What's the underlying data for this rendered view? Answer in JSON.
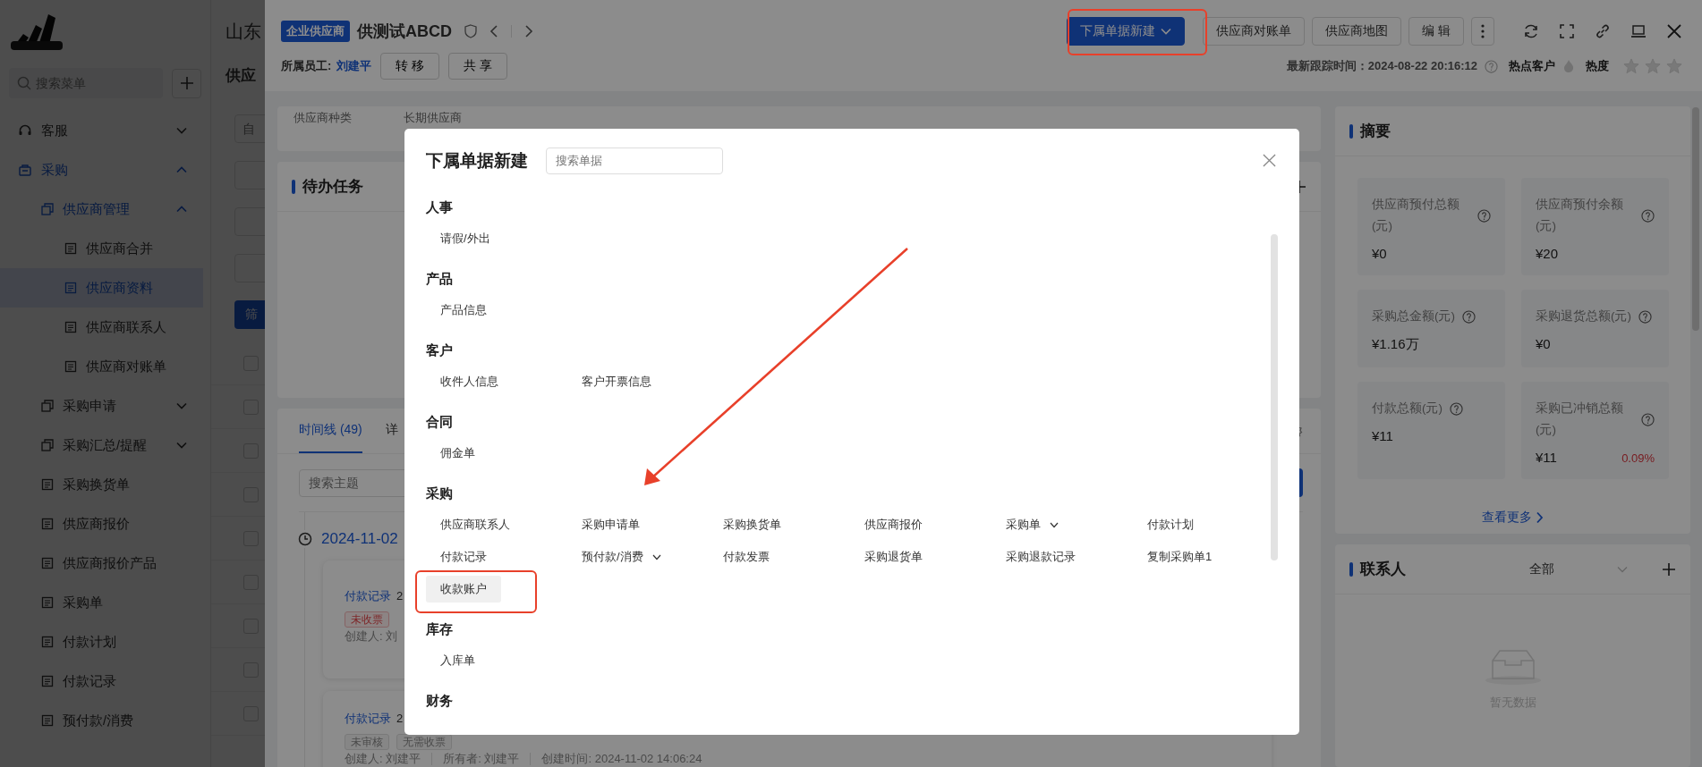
{
  "sidebar": {
    "search": {
      "placeholder": "搜索菜单"
    },
    "items": [
      {
        "label": "客服",
        "expanded": false
      },
      {
        "label": "采购",
        "expanded": true,
        "children": [
          {
            "label": "供应商管理",
            "expanded": true,
            "children": [
              {
                "label": "供应商合并",
                "selected": false
              },
              {
                "label": "供应商资料",
                "selected": true
              },
              {
                "label": "供应商联系人",
                "selected": false
              },
              {
                "label": "供应商对账单",
                "selected": false
              }
            ]
          },
          {
            "label": "采购申请",
            "expanded": false
          },
          {
            "label": "采购汇总/提醒",
            "expanded": false
          },
          {
            "label": "采购换货单",
            "selected": false
          },
          {
            "label": "供应商报价",
            "selected": false
          },
          {
            "label": "供应商报价产品",
            "selected": false
          },
          {
            "label": "采购单",
            "selected": false
          },
          {
            "label": "付款计划",
            "selected": false
          },
          {
            "label": "付款记录",
            "selected": false
          },
          {
            "label": "预付款/消费",
            "selected": false
          }
        ]
      }
    ]
  },
  "list_page": {
    "title": "山东",
    "subtitle": "供应",
    "filter_field": {
      "placeholder": "自"
    },
    "filter_button": "筛",
    "rows": [
      {
        "checked": false
      },
      {
        "checked": false
      },
      {
        "checked": false
      },
      {
        "checked": false
      },
      {
        "checked": false
      },
      {
        "checked": false
      },
      {
        "checked": false
      },
      {
        "checked": false
      },
      {
        "checked": false
      }
    ]
  },
  "drawer": {
    "tag": "企业供应商",
    "title": "供测试ABCD",
    "owner_label": "所属员工:",
    "owner": "刘建平",
    "buttons": [
      "转 移",
      "共 享"
    ],
    "actions": [
      {
        "label": "下属单据新建",
        "kind": "primary"
      },
      {
        "label": "供应商对账单",
        "kind": "default"
      },
      {
        "label": "供应商地图",
        "kind": "default"
      },
      {
        "label": "编 辑",
        "kind": "default"
      }
    ],
    "last_tracked": "最新跟踪时间：2024-08-22 20:16:12",
    "hot_label": "热点客户",
    "heat": {
      "label": "热度",
      "stars": 0
    },
    "info_labels": [
      "供应商种类",
      "长期供应商"
    ],
    "tasks": {
      "title": "待办任务"
    },
    "timeline": {
      "tabs": [
        {
          "label": "时间线 (49)",
          "selected": true
        },
        {
          "label": "详",
          "selected": false
        }
      ],
      "search": {
        "placeholder": "搜索主题"
      },
      "date": "2024-11-02",
      "entries": [
        {
          "type": "付款记录",
          "time": "2",
          "tags": [
            {
              "label": "未收票",
              "kind": "danger"
            }
          ],
          "meta": [
            "创建人: 刘"
          ]
        },
        {
          "type": "付款记录",
          "time": "2",
          "tags": [
            {
              "label": "未审核",
              "kind": "default"
            },
            {
              "label": "无需收票",
              "kind": "default"
            }
          ],
          "meta": [
            "创建人: 刘建平",
            "所有者: 刘建平",
            "创建时间: 2024-11-02 14:06:24"
          ]
        }
      ]
    },
    "summary": {
      "title": "摘要",
      "stats": [
        {
          "label": "供应商预付总额(元)",
          "value": "¥0"
        },
        {
          "label": "供应商预付余额(元)",
          "value": "¥20"
        },
        {
          "label": "采购总金额(元)",
          "value": "¥1.16万"
        },
        {
          "label": "采购退货总额(元)",
          "value": "¥0"
        },
        {
          "label": "付款总额(元)",
          "value": "¥11"
        },
        {
          "label": "采购已冲销总额(元)",
          "value": "¥11",
          "ratio": "0.09%"
        }
      ],
      "more_link": "查看更多"
    },
    "contacts": {
      "title": "联系人",
      "filter": "全部",
      "empty_text": "暂无数据"
    }
  },
  "modal": {
    "title": "下属单据新建",
    "search": {
      "placeholder": "搜索单据"
    },
    "sections": [
      {
        "title": "人事",
        "items": [
          {
            "label": "请假/外出",
            "kind": "link",
            "selected": false
          }
        ]
      },
      {
        "title": "产品",
        "items": [
          {
            "label": "产品信息",
            "kind": "link",
            "selected": false
          }
        ]
      },
      {
        "title": "客户",
        "items": [
          {
            "label": "收件人信息",
            "kind": "link",
            "selected": false
          },
          {
            "label": "客户开票信息",
            "kind": "link",
            "selected": false
          }
        ]
      },
      {
        "title": "合同",
        "items": [
          {
            "label": "佣金单",
            "kind": "link",
            "selected": false
          }
        ]
      },
      {
        "title": "采购",
        "items": [
          {
            "label": "供应商联系人",
            "kind": "link",
            "selected": false
          },
          {
            "label": "采购申请单",
            "kind": "link",
            "selected": false
          },
          {
            "label": "采购换货单",
            "kind": "link",
            "selected": false
          },
          {
            "label": "供应商报价",
            "kind": "link",
            "selected": false
          },
          {
            "label": "采购单",
            "kind": "dropdown",
            "selected": false
          },
          {
            "label": "付款计划",
            "kind": "link",
            "selected": false
          },
          {
            "label": "付款记录",
            "kind": "link",
            "selected": false
          },
          {
            "label": "预付款/消费",
            "kind": "dropdown",
            "selected": false
          },
          {
            "label": "付款发票",
            "kind": "link",
            "selected": false
          },
          {
            "label": "采购退货单",
            "kind": "link",
            "selected": false
          },
          {
            "label": "采购退款记录",
            "kind": "link",
            "selected": false
          },
          {
            "label": "复制采购单1",
            "kind": "link",
            "selected": false
          },
          {
            "label": "收款账户",
            "kind": "link",
            "selected": true
          }
        ]
      },
      {
        "title": "库存",
        "items": [
          {
            "label": "入库单",
            "kind": "link",
            "selected": false
          }
        ]
      },
      {
        "title": "财务"
      }
    ]
  }
}
